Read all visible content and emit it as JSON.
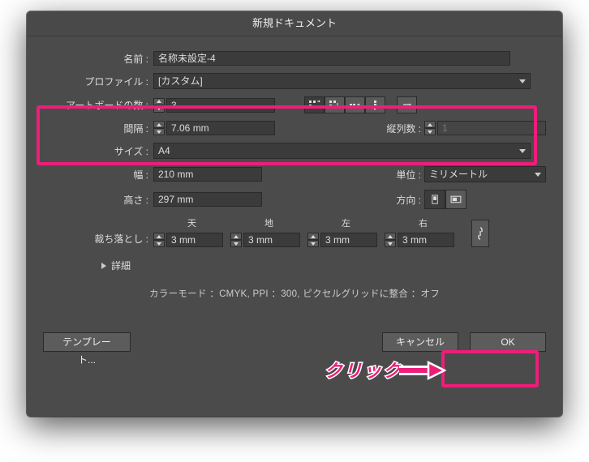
{
  "title": "新規ドキュメント",
  "labels": {
    "name": "名前",
    "profile": "プロファイル",
    "artboards": "アートボードの数",
    "spacing": "間隔",
    "columns": "縦列数",
    "size": "サイズ",
    "width": "幅",
    "units": "単位",
    "height": "高さ",
    "orientation": "方向",
    "bleed": "裁ち落とし",
    "top": "天",
    "bottom": "地",
    "left": "左",
    "right": "右",
    "details": "詳細"
  },
  "values": {
    "name": "名称未設定-4",
    "profile": "[カスタム]",
    "artboards": "3",
    "spacing": "7.06 mm",
    "columns": "1",
    "size": "A4",
    "width": "210 mm",
    "height": "297 mm",
    "units": "ミリメートル",
    "bleed_top": "3 mm",
    "bleed_bottom": "3 mm",
    "bleed_left": "3 mm",
    "bleed_right": "3 mm"
  },
  "info": "カラーモード ：CMYK, PPI ：300, ピクセルグリッドに整合 ：オフ",
  "buttons": {
    "template": "テンプレート...",
    "cancel": "キャンセル",
    "ok": "OK"
  },
  "annotation": {
    "click": "クリック"
  }
}
